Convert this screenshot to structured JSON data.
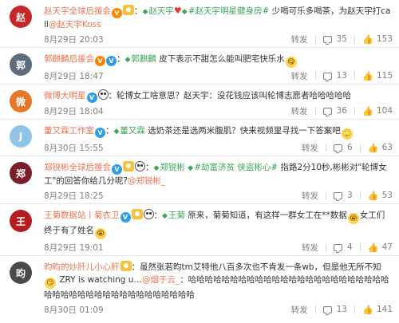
{
  "labels": {
    "share": "转发",
    "reply_icon": "comment-icon",
    "like_icon": "thumb-up-icon"
  },
  "colors": {
    "username": "#eb7350",
    "topic": "#3ca556",
    "meta": "#808080",
    "vip_badge": "#ff8200",
    "blue_badge": "#2f9de6",
    "divider": "#eaeaea"
  },
  "comments": [
    {
      "username": "赵天宇全球后援会",
      "avatar_color": "#c62828",
      "avatar_glyph": "赵",
      "parts": [
        {
          "text": "赵天宇",
          "style": "topic",
          "prefix": "◆ "
        },
        {
          "text": "♥",
          "style": "heart"
        },
        {
          "text": "#赵天宇明星健身房#",
          "style": "topic",
          "prefix": "◆ "
        },
        {
          "text": " 少喝可乐多喝茶，为赵天宇打call",
          "style": "plain"
        },
        {
          "text": "@赵天宇Koss",
          "style": "mention"
        }
      ],
      "time": "8月29日 20:03",
      "share": "转发",
      "reply_count": "35",
      "like_count": "153"
    },
    {
      "username": "郭麒麟后援会",
      "avatar_color": "#5d6d7e",
      "avatar_glyph": "郭",
      "parts": [
        {
          "text": "郭麒麟",
          "style": "topic",
          "prefix": "◆ "
        },
        {
          "text": " 皮下表示不甜怎么能叫肥宅快乐水",
          "style": "plain"
        },
        {
          "text": "😋",
          "style": "emoji"
        }
      ],
      "time": "8月29日 18:47",
      "share": "转发",
      "reply_count": "13",
      "like_count": "115"
    },
    {
      "username": "微博大明星",
      "avatar_color": "#e6762a",
      "avatar_glyph": "微",
      "parts": [
        {
          "text": "轮博女工啥意思？赵天宇：没花钱应该叫轮博志愿者哈哈哈哈哈",
          "style": "plain"
        }
      ],
      "time": "8月29日 18:04",
      "share": "转发",
      "reply_count": "36",
      "like_count": "104"
    },
    {
      "username": "董又霖工作室",
      "avatar_color": "#8fc3e8",
      "avatar_glyph": "J",
      "parts": [
        {
          "text": "董又霖",
          "style": "topic",
          "prefix": "◆ "
        },
        {
          "text": " 选奶茶还是选两米腹肌？快来视频里寻找一下答案吧",
          "style": "plain"
        },
        {
          "text": "🙄",
          "style": "emoji"
        }
      ],
      "time": "8月30日 15:55",
      "share": "转发",
      "reply_count": "6",
      "like_count": "63"
    },
    {
      "username": "郑锐彬全球后援会",
      "avatar_color": "#7b1f2b",
      "avatar_glyph": "郑",
      "parts": [
        {
          "text": "郑锐彬",
          "style": "topic",
          "prefix": "◆ "
        },
        {
          "text": " ",
          "style": "plain"
        },
        {
          "text": "#劫富济贫 侠盗彬心#",
          "style": "topic",
          "prefix": "◆ "
        },
        {
          "text": " 指路2分10秒,彬彬对\"轮博女工\"的回答你给几分呢?",
          "style": "plain"
        },
        {
          "text": "@郑锐彬_",
          "style": "mention"
        }
      ],
      "time": "8月29日 18:25",
      "share": "转发",
      "reply_count": "3",
      "like_count": "53"
    },
    {
      "username": "王菊数据站丨菊衣卫",
      "avatar_color": "#b71c1c",
      "avatar_glyph": "王",
      "parts": [
        {
          "text": "王菊",
          "style": "topic",
          "prefix": "◆ "
        },
        {
          "text": " 原来，菊菊知道，有这样一群女工在**数据",
          "style": "plain"
        },
        {
          "text": "😭",
          "style": "emoji"
        },
        {
          "text": "女工们终于有了姓名",
          "style": "plain"
        },
        {
          "text": "😭",
          "style": "emoji"
        }
      ],
      "time": "8月29日 19:01",
      "share": "转发",
      "reply_count": "4",
      "like_count": "47"
    },
    {
      "username": "昀昀的炒肝儿小心肝",
      "avatar_color": "#4a4a4a",
      "avatar_glyph": "昀",
      "parts": [
        {
          "text": "：虽然张若昀tm艾特他八百多次也不肯发一条wb，但是他无所不知",
          "style": "plain"
        },
        {
          "text": "😏",
          "style": "emoji"
        },
        {
          "text": " ZRY is watching u…",
          "style": "plain"
        },
        {
          "text": "@烟于云_",
          "style": "mention"
        },
        {
          "text": "：哈哈哈哈哈哈哈哈哈哈哈哈哈哈哈哈哈哈哈哈哈哈哈哈哈哈哈哈哈哈哈哈哈哈哈哈哈哈哈哈哈哈",
          "style": "plain"
        }
      ],
      "time": "8月30日 01:09",
      "share": "转发",
      "reply_count": "13",
      "like_count": "141"
    }
  ]
}
